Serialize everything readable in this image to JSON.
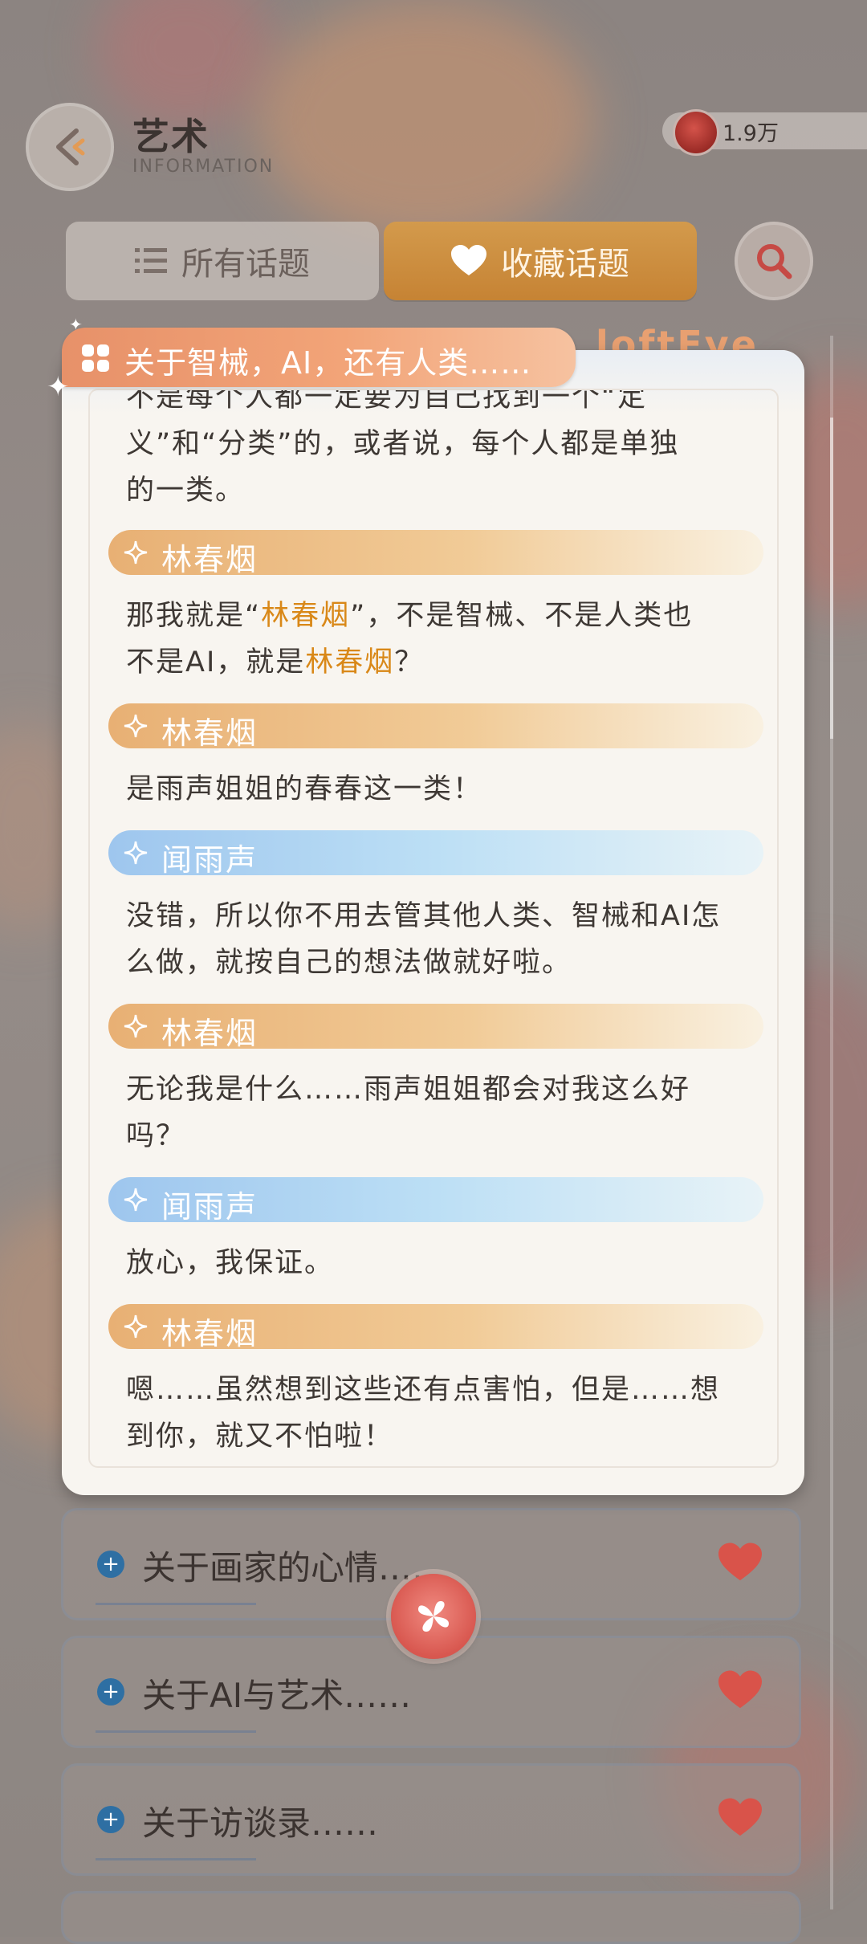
{
  "header": {
    "title": "艺术",
    "subtitle": "INFORMATION",
    "currency_value": "1.9万"
  },
  "tabs": {
    "all_label": "所有话题",
    "favorites_label": "收藏话题"
  },
  "dialog": {
    "title": "关于智械，AI，还有人类……",
    "intro_lines": [
      "不是每个人都一定要为自己找到一个“定",
      "义”和“分类”的，或者说，每个人都是单独",
      "的一类。"
    ],
    "entries": [
      {
        "speaker": "林春烟",
        "lines": [
          {
            "pre": "那我就是“",
            "hl": "林春烟",
            "post": "”，不是智械、不是人类也"
          },
          {
            "pre": "不是AI，就是",
            "hl": "林春烟",
            "post": "？"
          }
        ]
      },
      {
        "speaker": "林春烟",
        "lines": [
          {
            "pre": "是雨声姐姐的春春这一类！",
            "hl": "",
            "post": ""
          }
        ]
      },
      {
        "speaker": "闻雨声",
        "lines": [
          {
            "pre": "没错，所以你不用去管其他人类、智械和AI怎",
            "hl": "",
            "post": ""
          },
          {
            "pre": "么做，就按自己的想法做就好啦。",
            "hl": "",
            "post": ""
          }
        ]
      },
      {
        "speaker": "林春烟",
        "lines": [
          {
            "pre": "无论我是什么……雨声姐姐都会对我这么好",
            "hl": "",
            "post": ""
          },
          {
            "pre": "吗？",
            "hl": "",
            "post": ""
          }
        ]
      },
      {
        "speaker": "闻雨声",
        "lines": [
          {
            "pre": "放心，我保证。",
            "hl": "",
            "post": ""
          }
        ]
      },
      {
        "speaker": "林春烟",
        "lines": [
          {
            "pre": "嗯……虽然想到这些还有点害怕，但是……想",
            "hl": "",
            "post": ""
          },
          {
            "pre": "到你，就又不怕啦！",
            "hl": "",
            "post": ""
          }
        ]
      }
    ]
  },
  "topics": [
    {
      "label": "关于画家的心情……"
    },
    {
      "label": "关于AI与艺术……"
    },
    {
      "label": "关于访谈录……"
    }
  ],
  "colors": {
    "highlight": "#d98818",
    "speaker_orange": "#e8b074",
    "speaker_blue": "#9ec6ee",
    "favorite_tab": "#c68334",
    "close_button": "#d8574f",
    "heart": "#d9534a"
  },
  "icons": {
    "back": "back-arrow-icon",
    "currency": "avatar-coin-icon",
    "search": "search-icon",
    "close": "close-icon",
    "heart": "heart-icon"
  }
}
